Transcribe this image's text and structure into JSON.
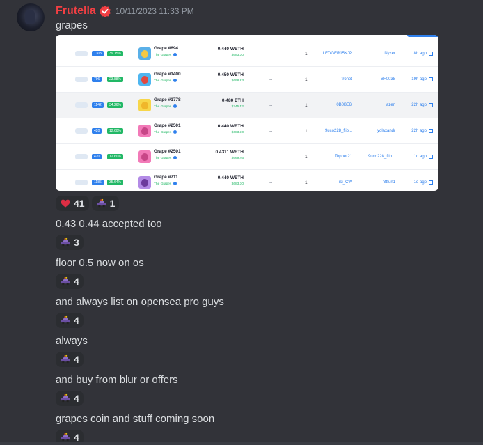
{
  "message": {
    "username": "Frutella",
    "timestamp": "10/11/2023 11:33 PM",
    "first_text": "grapes",
    "embed_rows": [
      {
        "gray_count": "1305",
        "pct": "39.15%",
        "thumb_color": "#5ab0e8",
        "face_color": "#f6c945",
        "name": "Grape #694",
        "collection": "The Grapes",
        "price": "0.440 WETH",
        "usd": "$683.30",
        "dash": "--",
        "qty": "1",
        "from": "LEDGER15KJP",
        "to": "Nyzer",
        "ago": "8h ago"
      },
      {
        "gray_count": "796",
        "pct": "23.88%",
        "thumb_color": "#4fb6f0",
        "face_color": "#e2483f",
        "name": "Grape #1400",
        "collection": "The Grapes",
        "price": "0.450 WETH",
        "usd": "$698.83",
        "dash": "--",
        "qty": "1",
        "from": "tronet",
        "to": "BF0038",
        "ago": "19h ago"
      },
      {
        "gray_count": "1142",
        "pct": "34.26%",
        "thumb_color": "#f7d64a",
        "face_color": "#f0b62b",
        "name": "Grape #1778",
        "collection": "The Grapes",
        "price": "0.480 ETH",
        "usd": "$745.52",
        "dash": "--",
        "qty": "1",
        "from": "0B0BEB",
        "to": "jazen",
        "ago": "22h ago"
      },
      {
        "gray_count": "420",
        "pct": "12.60%",
        "thumb_color": "#f27ab8",
        "face_color": "#c74687",
        "name": "Grape #2501",
        "collection": "The Grapes",
        "price": "0.440 WETH",
        "usd": "$683.30",
        "dash": "--",
        "qty": "1",
        "from": "9uco228_flip...",
        "to": "yolaxandr",
        "ago": "22h ago"
      },
      {
        "gray_count": "420",
        "pct": "12.60%",
        "thumb_color": "#f27ab8",
        "face_color": "#c74687",
        "name": "Grape #2501",
        "collection": "The Grapes",
        "price": "0.4311 WETH",
        "usd": "$669.46",
        "dash": "--",
        "qty": "1",
        "from": "Topher21",
        "to": "9uco228_flip...",
        "ago": "1d ago"
      },
      {
        "gray_count": "1186",
        "pct": "35.64%",
        "thumb_color": "#b38be6",
        "face_color": "#6b3a9c",
        "name": "Grape #711",
        "collection": "The Grapes",
        "price": "0.440 WETH",
        "usd": "$683.30",
        "dash": "--",
        "qty": "1",
        "from": "isi_CW",
        "to": "nftfun1",
        "ago": "1d ago"
      }
    ],
    "first_reactions": [
      {
        "emoji": "heart-icon",
        "count": "41"
      },
      {
        "emoji": "grape-car-emoji-icon",
        "count": "1"
      }
    ],
    "followups": [
      {
        "text": "0.43 0.44 accepted too",
        "reaction_count": "3"
      },
      {
        "text": "floor 0.5 now on os",
        "reaction_count": "4"
      },
      {
        "text": "and always list on opensea pro guys",
        "reaction_count": "4"
      },
      {
        "text": "always",
        "reaction_count": "4"
      },
      {
        "text": "and buy from blur or offers",
        "reaction_count": "4"
      },
      {
        "text": "grapes coin and stuff coming soon",
        "reaction_count": "4"
      }
    ]
  },
  "colors": {
    "background": "#323339",
    "username": "#f23f43",
    "reaction_bg": "#2b2d31",
    "link_blue": "#2f80ed",
    "green": "#22b866"
  }
}
